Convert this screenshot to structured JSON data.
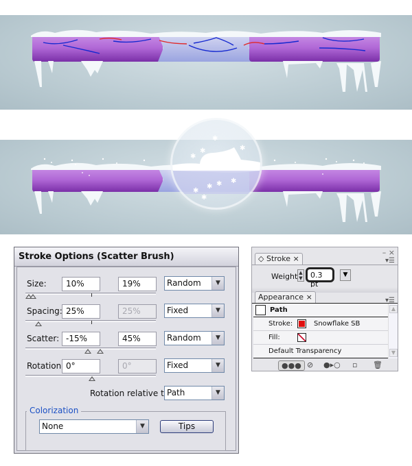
{
  "illustrations": {
    "top_banner": {
      "description": "purple progress bar with snow and blue/red scatter brush paths",
      "colors": {
        "bar": "#b36ad8",
        "center": "#c4c8ec",
        "path_blue": "#1428d0",
        "path_red": "#e02828",
        "background": "#bccbd2"
      }
    },
    "bottom_banner": {
      "description": "purple progress bar with snow, snowflakes and magnified globe",
      "colors": {
        "bar": "#b36ad8",
        "center": "#c4c8ec",
        "background": "#bccbd2"
      }
    }
  },
  "stroke_options": {
    "title": "Stroke Options (Scatter Brush)",
    "rows": [
      {
        "label": "Size:",
        "min": "10%",
        "max": "19%",
        "mode": "Random",
        "max_disabled": false
      },
      {
        "label": "Spacing:",
        "min": "25%",
        "max": "25%",
        "mode": "Fixed",
        "max_disabled": true
      },
      {
        "label": "Scatter:",
        "min": "-15%",
        "max": "45%",
        "mode": "Random",
        "max_disabled": false
      },
      {
        "label": "Rotation:",
        "min": "0°",
        "max": "0°",
        "mode": "Fixed",
        "max_disabled": true
      }
    ],
    "rotation_relative_label": "Rotation relative to:",
    "rotation_relative_value": "Path",
    "colorization": {
      "legend": "Colorization",
      "method": "None",
      "tips_label": "Tips"
    }
  },
  "stroke_panel": {
    "tab_label": "Stroke",
    "tab_icon": "◇",
    "close_glyph": "×",
    "weight_label": "Weight:",
    "weight_value": "0.3 pt",
    "minimize_glyph": "–",
    "menu_glyph": "▾☰"
  },
  "appearance_panel": {
    "tab_label": "Appearance",
    "close_glyph": "×",
    "rows": [
      {
        "label": "Path"
      },
      {
        "label": "Stroke:",
        "value": "Snowflake SB",
        "swatch": "#e01010"
      },
      {
        "label": "Fill:",
        "swatch": "none"
      },
      {
        "label": "Default Transparency"
      }
    ]
  }
}
